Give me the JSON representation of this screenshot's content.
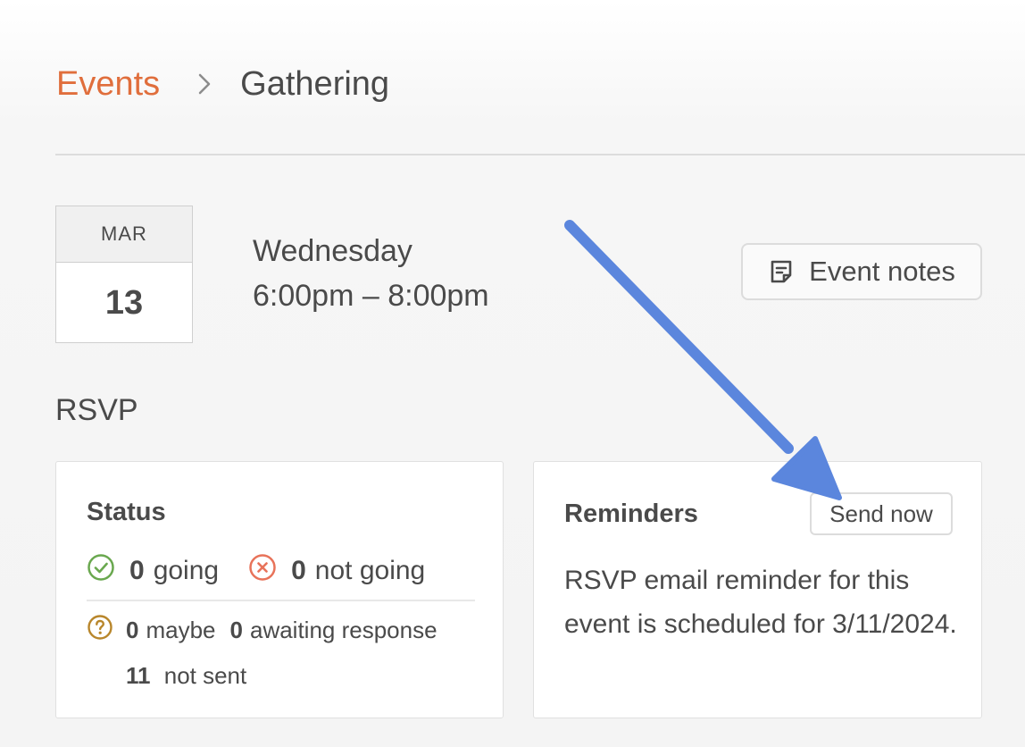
{
  "breadcrumb": {
    "parent": "Events",
    "current": "Gathering"
  },
  "event": {
    "month": "MAR",
    "day": "13",
    "weekday": "Wednesday",
    "time_range": "6:00pm – 8:00pm",
    "notes_button": "Event notes"
  },
  "rsvp": {
    "heading": "RSVP",
    "status": {
      "title": "Status",
      "going_count": "0",
      "going_label": "going",
      "not_going_count": "0",
      "not_going_label": "not going",
      "maybe_count": "0",
      "maybe_label": "maybe",
      "awaiting_count": "0",
      "awaiting_label": "awaiting response",
      "not_sent_count": "11",
      "not_sent_label": "not sent"
    },
    "reminders": {
      "title": "Reminders",
      "send_button": "Send now",
      "message": "RSVP email reminder for this event is scheduled for 3/11/2024."
    }
  },
  "colors": {
    "accent": "#e06e3c",
    "going": "#6aa84f",
    "not_going": "#e8735a",
    "maybe": "#b8862b",
    "annotation_arrow": "#5b86dd"
  },
  "icons": {
    "breadcrumb_separator": "chevron-right-icon",
    "notes": "note-icon",
    "going": "check-circle-icon",
    "not_going": "x-circle-icon",
    "maybe": "question-circle-icon",
    "annotation": "arrow-annotation"
  }
}
